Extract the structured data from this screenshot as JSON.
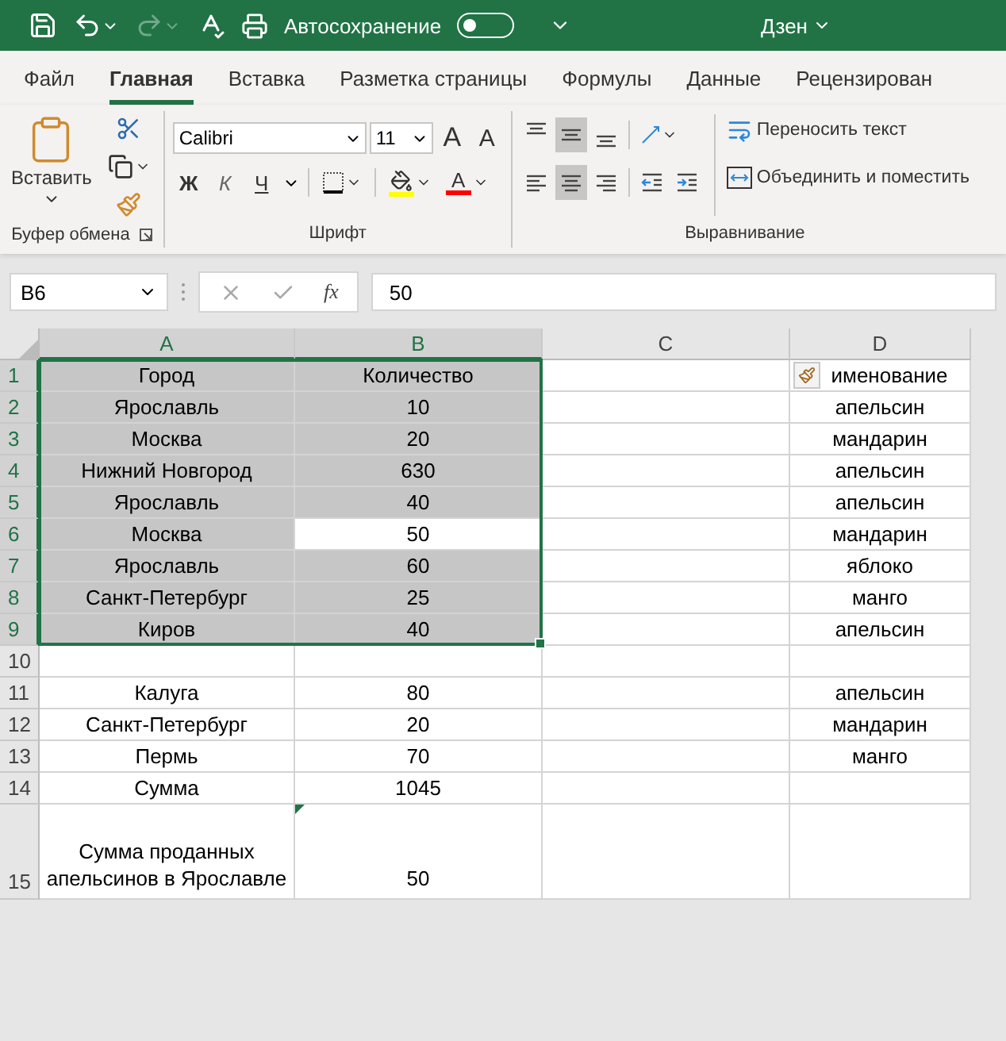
{
  "title_bar": {
    "autosave": {
      "label": "Автосохранение",
      "on": false
    },
    "account": "Дзен"
  },
  "tabs": [
    {
      "label": "Файл",
      "selected": false
    },
    {
      "label": "Главная",
      "selected": true
    },
    {
      "label": "Вставка",
      "selected": false
    },
    {
      "label": "Разметка страницы",
      "selected": false
    },
    {
      "label": "Формулы",
      "selected": false
    },
    {
      "label": "Данные",
      "selected": false
    },
    {
      "label": "Рецензирован",
      "selected": false
    }
  ],
  "ribbon": {
    "clipboard": {
      "paste_label": "Вставить",
      "group_label": "Буфер обмена"
    },
    "font": {
      "name": "Calibri",
      "size": "11",
      "grow": "A",
      "shrink": "A",
      "bold": "Ж",
      "italic": "К",
      "underline": "Ч",
      "font_color_letter": "A",
      "group_label": "Шрифт"
    },
    "alignment": {
      "vertical": [
        {
          "kind": "top",
          "selected": false
        },
        {
          "kind": "middle",
          "selected": true
        },
        {
          "kind": "bottom",
          "selected": false
        }
      ],
      "horizontal": [
        {
          "kind": "left",
          "selected": false
        },
        {
          "kind": "center",
          "selected": true
        },
        {
          "kind": "right",
          "selected": false
        }
      ],
      "wrap_text": "Переносить текст",
      "merge": "Объединить и поместить",
      "group_label": "Выравнивание"
    }
  },
  "formula_bar": {
    "name_box": "B6",
    "function_label": "fx",
    "value": "50"
  },
  "sheet": {
    "columns": [
      {
        "label": "A",
        "selected": true
      },
      {
        "label": "B",
        "selected": true
      },
      {
        "label": "C",
        "selected": false
      },
      {
        "label": "D",
        "selected": false
      }
    ],
    "rows": [
      {
        "number": "1",
        "selected": true,
        "cells": [
          {
            "text": "Город",
            "selected": true
          },
          {
            "text": "Количество",
            "selected": true
          },
          {
            "text": "",
            "selected": false
          },
          {
            "text": "именование",
            "selected": false
          }
        ]
      },
      {
        "number": "2",
        "selected": true,
        "cells": [
          {
            "text": "Ярославль",
            "selected": true
          },
          {
            "text": "10",
            "selected": true
          },
          {
            "text": "",
            "selected": false
          },
          {
            "text": "апельсин",
            "selected": false
          }
        ]
      },
      {
        "number": "3",
        "selected": true,
        "cells": [
          {
            "text": "Москва",
            "selected": true
          },
          {
            "text": "20",
            "selected": true
          },
          {
            "text": "",
            "selected": false
          },
          {
            "text": "мандарин",
            "selected": false
          }
        ]
      },
      {
        "number": "4",
        "selected": true,
        "cells": [
          {
            "text": "Нижний Новгород",
            "selected": true
          },
          {
            "text": "630",
            "selected": true
          },
          {
            "text": "",
            "selected": false
          },
          {
            "text": "апельсин",
            "selected": false
          }
        ]
      },
      {
        "number": "5",
        "selected": true,
        "cells": [
          {
            "text": "Ярославль",
            "selected": true
          },
          {
            "text": "40",
            "selected": true
          },
          {
            "text": "",
            "selected": false
          },
          {
            "text": "апельсин",
            "selected": false
          }
        ]
      },
      {
        "number": "6",
        "selected": true,
        "cells": [
          {
            "text": "Москва",
            "selected": true
          },
          {
            "text": "50",
            "selected": true,
            "active": true
          },
          {
            "text": "",
            "selected": false
          },
          {
            "text": "мандарин",
            "selected": false
          }
        ]
      },
      {
        "number": "7",
        "selected": true,
        "cells": [
          {
            "text": "Ярославль",
            "selected": true
          },
          {
            "text": "60",
            "selected": true
          },
          {
            "text": "",
            "selected": false
          },
          {
            "text": "яблоко",
            "selected": false
          }
        ]
      },
      {
        "number": "8",
        "selected": true,
        "cells": [
          {
            "text": "Санкт-Петербург",
            "selected": true
          },
          {
            "text": "25",
            "selected": true
          },
          {
            "text": "",
            "selected": false
          },
          {
            "text": "манго",
            "selected": false
          }
        ]
      },
      {
        "number": "9",
        "selected": true,
        "cells": [
          {
            "text": "Киров",
            "selected": true
          },
          {
            "text": "40",
            "selected": true
          },
          {
            "text": "",
            "selected": false
          },
          {
            "text": "апельсин",
            "selected": false
          }
        ]
      },
      {
        "number": "10",
        "selected": false,
        "cells": [
          {
            "text": "",
            "selected": false
          },
          {
            "text": "",
            "selected": false
          },
          {
            "text": "",
            "selected": false
          },
          {
            "text": "",
            "selected": false
          }
        ]
      },
      {
        "number": "11",
        "selected": false,
        "cells": [
          {
            "text": "Калуга",
            "selected": false
          },
          {
            "text": "80",
            "selected": false
          },
          {
            "text": "",
            "selected": false
          },
          {
            "text": "апельсин",
            "selected": false
          }
        ]
      },
      {
        "number": "12",
        "selected": false,
        "cells": [
          {
            "text": "Санкт-Петербург",
            "selected": false
          },
          {
            "text": "20",
            "selected": false
          },
          {
            "text": "",
            "selected": false
          },
          {
            "text": "мандарин",
            "selected": false
          }
        ]
      },
      {
        "number": "13",
        "selected": false,
        "cells": [
          {
            "text": "Пермь",
            "selected": false
          },
          {
            "text": "70",
            "selected": false
          },
          {
            "text": "",
            "selected": false
          },
          {
            "text": "манго",
            "selected": false
          }
        ]
      },
      {
        "number": "14",
        "selected": false,
        "cells": [
          {
            "text": "Сумма",
            "selected": false
          },
          {
            "text": "1045",
            "selected": false
          },
          {
            "text": "",
            "selected": false
          },
          {
            "text": "",
            "selected": false
          }
        ]
      },
      {
        "number": "15",
        "selected": false,
        "tall": true,
        "cells": [
          {
            "text": "Сумма проданных апельсинов в Ярославле",
            "selected": false
          },
          {
            "text": "50",
            "selected": false,
            "error_flag": true
          },
          {
            "text": "",
            "selected": false
          },
          {
            "text": "",
            "selected": false
          }
        ]
      }
    ]
  }
}
